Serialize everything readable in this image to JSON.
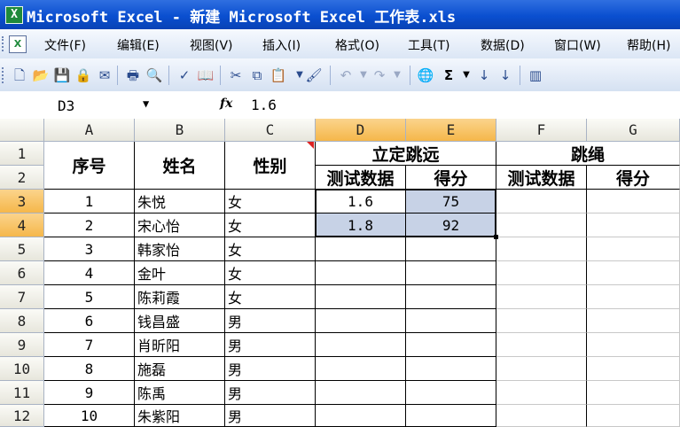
{
  "window": {
    "title": "Microsoft Excel - 新建 Microsoft Excel 工作表.xls"
  },
  "menu": {
    "items": [
      {
        "label": "文件(F)"
      },
      {
        "label": "编辑(E)"
      },
      {
        "label": "视图(V)"
      },
      {
        "label": "插入(I)"
      },
      {
        "label": "格式(O)"
      },
      {
        "label": "工具(T)"
      },
      {
        "label": "数据(D)"
      },
      {
        "label": "窗口(W)"
      },
      {
        "label": "帮助(H)"
      }
    ]
  },
  "toolbar": {
    "icons": [
      "new-icon",
      "open-icon",
      "save-icon",
      "permission-icon",
      "email-icon",
      "print-icon",
      "print-preview-icon",
      "spelling-icon",
      "research-icon",
      "cut-icon",
      "copy-icon",
      "paste-icon",
      "format-painter-icon",
      "undo-icon",
      "redo-icon",
      "hyperlink-icon",
      "autosum-icon",
      "sort-ascending-icon",
      "sort-descending-icon",
      "chart-icon"
    ]
  },
  "formula_bar": {
    "name_box": "D3",
    "fx_label": "fx",
    "value": "1.6"
  },
  "sheet": {
    "columns": [
      "A",
      "B",
      "C",
      "D",
      "E",
      "F",
      "G"
    ],
    "rows": [
      "1",
      "2",
      "3",
      "4",
      "5",
      "6",
      "7",
      "8",
      "9",
      "10",
      "11",
      "12"
    ],
    "header": {
      "seq": "序号",
      "name": "姓名",
      "gender": "性别",
      "long_jump": "立定跳远",
      "jump_rope": "跳绳",
      "test_data": "测试数据",
      "score": "得分"
    },
    "data": [
      {
        "seq": "1",
        "name": "朱悦",
        "gender": "女",
        "d": "1.6",
        "e": "75"
      },
      {
        "seq": "2",
        "name": "宋心怡",
        "gender": "女",
        "d": "1.8",
        "e": "92"
      },
      {
        "seq": "3",
        "name": "韩家怡",
        "gender": "女",
        "d": "",
        "e": ""
      },
      {
        "seq": "4",
        "name": "金叶",
        "gender": "女",
        "d": "",
        "e": ""
      },
      {
        "seq": "5",
        "name": "陈莉霞",
        "gender": "女",
        "d": "",
        "e": ""
      },
      {
        "seq": "6",
        "name": "钱昌盛",
        "gender": "男",
        "d": "",
        "e": ""
      },
      {
        "seq": "7",
        "name": "肖昕阳",
        "gender": "男",
        "d": "",
        "e": ""
      },
      {
        "seq": "8",
        "name": "施磊",
        "gender": "男",
        "d": "",
        "e": ""
      },
      {
        "seq": "9",
        "name": "陈禹",
        "gender": "男",
        "d": "",
        "e": ""
      },
      {
        "seq": "10",
        "name": "朱紫阳",
        "gender": "男",
        "d": "",
        "e": ""
      }
    ]
  }
}
